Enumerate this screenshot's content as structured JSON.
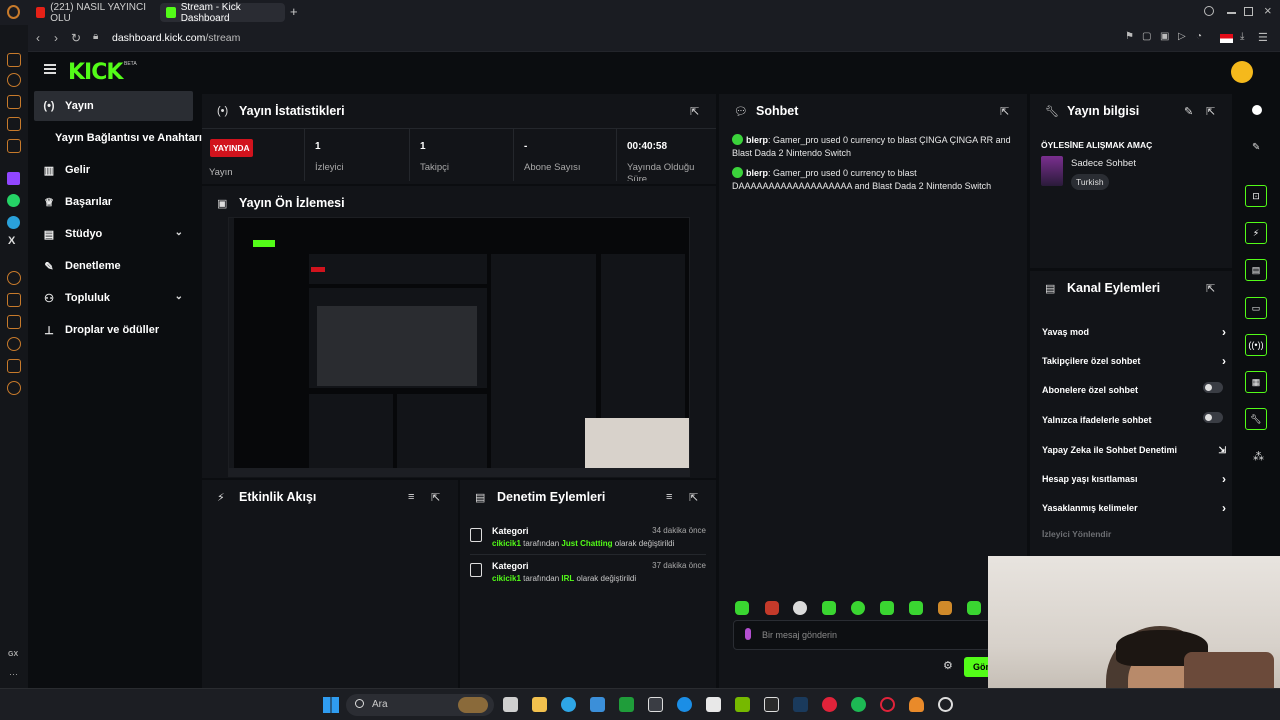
{
  "browser": {
    "tabs": [
      {
        "label": "(221) NASIL YAYINCI OLU"
      },
      {
        "label": "Stream - Kick Dashboard"
      }
    ],
    "new_tab_label": "+",
    "url_domain": "dashboard.kick.com",
    "url_path": "/stream"
  },
  "app": {
    "logo": "KICK",
    "logo_badge": "BETA"
  },
  "sidebar": {
    "items": [
      {
        "label": "Yayın",
        "icon": "live-icon"
      },
      {
        "label": "Yayın Bağlantısı ve Anahtarı",
        "icon": ""
      },
      {
        "label": "Gelir",
        "icon": "chart-icon"
      },
      {
        "label": "Başarılar",
        "icon": "trophy-icon"
      },
      {
        "label": "Stüdyo",
        "icon": "studio-icon"
      },
      {
        "label": "Denetleme",
        "icon": "wrench-icon"
      },
      {
        "label": "Topluluk",
        "icon": "community-icon"
      },
      {
        "label": "Droplar ve ödüller",
        "icon": "drops-icon"
      }
    ]
  },
  "stats": {
    "title": "Yayın İstatistikleri",
    "live_badge": "YAYINDA",
    "live_label": "Yayın",
    "items": [
      {
        "value": "1",
        "label": "İzleyici"
      },
      {
        "value": "1",
        "label": "Takipçi"
      },
      {
        "value": "-",
        "label": "Abone Sayısı"
      },
      {
        "value": "00:40:58",
        "label": "Yayında Olduğu Süre"
      }
    ]
  },
  "preview": {
    "title": "Yayın Ön İzlemesi"
  },
  "activity": {
    "title": "Etkinlik Akışı"
  },
  "modlog": {
    "title": "Denetim Eylemleri",
    "entries": [
      {
        "title": "Kategori",
        "time": "34 dakika önce",
        "user": "cikicik1",
        "pre": " tarafından ",
        "category": "Just Chatting",
        "post": " olarak değiştirildi"
      },
      {
        "title": "Kategori",
        "time": "37 dakika önce",
        "user": "cikicik1",
        "pre": " tarafından ",
        "category": "IRL",
        "post": " olarak değiştirildi"
      }
    ]
  },
  "chat": {
    "title": "Sohbet",
    "messages": [
      {
        "user": "blerp",
        "text": ": Gamer_pro used 0 currency to blast ÇINGA ÇINGA RR and Blast Dada 2 Nintendo Switch"
      },
      {
        "user": "blerp",
        "text": ": Gamer_pro used 0 currency to blast DAAAAAAAAAAAAAAAAAAA and Blast Dada 2 Nintendo Switch"
      }
    ],
    "input_placeholder": "Bir mesaj gönderin",
    "send_label": "Gönder"
  },
  "stream_info": {
    "title": "Yayın bilgisi",
    "stream_title": "ÖYLESİNE ALIŞMAK AMAÇ",
    "category": "Sadece Sohbet",
    "language": "Turkish"
  },
  "channel_actions": {
    "title": "Kanal Eylemleri",
    "items": [
      {
        "label": "Yavaş mod",
        "control": "arrow"
      },
      {
        "label": "Takipçilere özel sohbet",
        "control": "arrow"
      },
      {
        "label": "Abonelere özel sohbet",
        "control": "toggle"
      },
      {
        "label": "Yalnızca ifadelerle sohbet",
        "control": "toggle"
      },
      {
        "label": "Yapay Zeka ile Sohbet Denetimi",
        "control": "external"
      },
      {
        "label": "Hesap yaşı kısıtlaması",
        "control": "arrow"
      },
      {
        "label": "Yasaklanmış kelimeler",
        "control": "arrow"
      }
    ],
    "section_label": "İzleyici Yönlendir"
  },
  "taskbar": {
    "search_label": "Ara"
  },
  "opera": {
    "gx_label": "GX"
  },
  "colors": {
    "accent": "#53fc18",
    "live": "#d1131d",
    "panel": "#121418",
    "background": "#0b0d10"
  }
}
